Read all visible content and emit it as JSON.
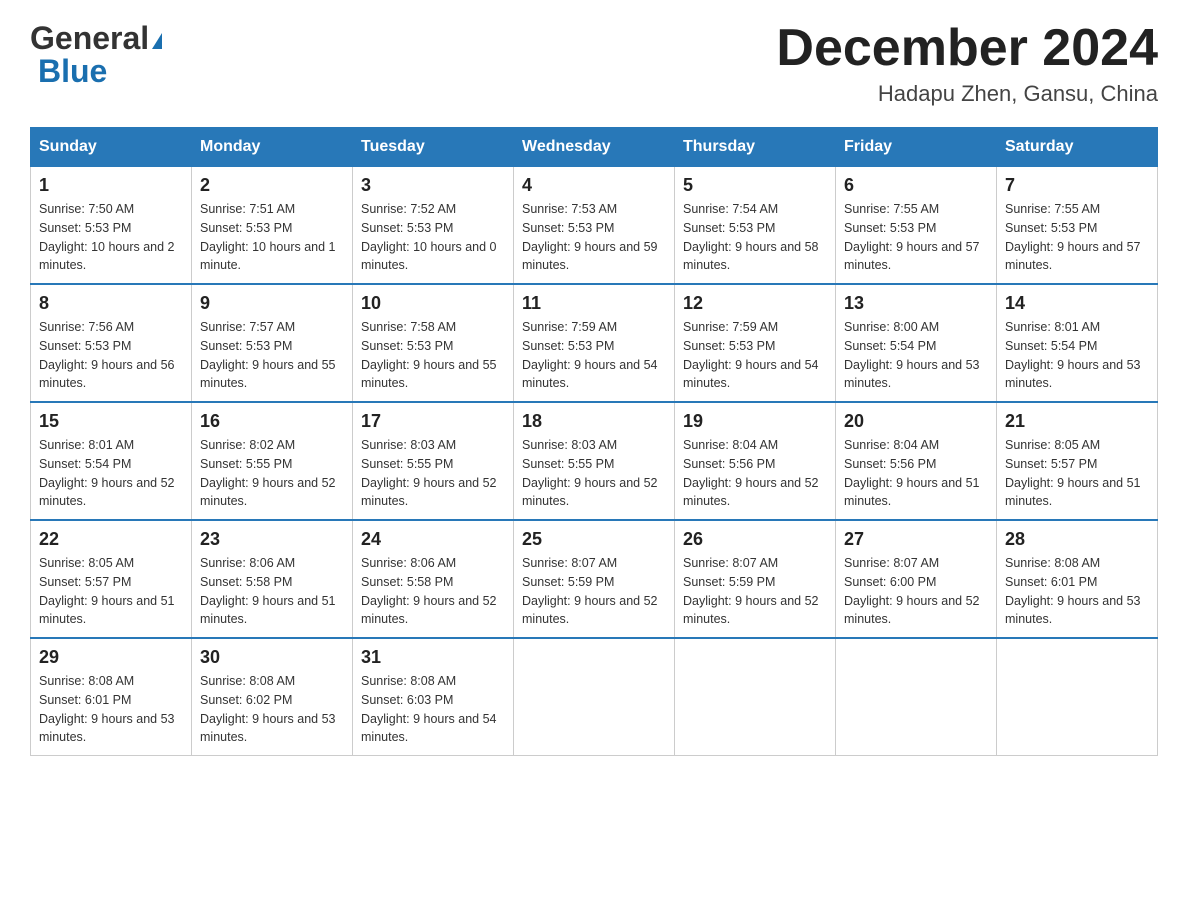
{
  "header": {
    "logo_general": "General",
    "logo_blue": "Blue",
    "title": "December 2024",
    "subtitle": "Hadapu Zhen, Gansu, China"
  },
  "days_of_week": [
    "Sunday",
    "Monday",
    "Tuesday",
    "Wednesday",
    "Thursday",
    "Friday",
    "Saturday"
  ],
  "weeks": [
    [
      {
        "day": "1",
        "sunrise": "7:50 AM",
        "sunset": "5:53 PM",
        "daylight": "10 hours and 2 minutes."
      },
      {
        "day": "2",
        "sunrise": "7:51 AM",
        "sunset": "5:53 PM",
        "daylight": "10 hours and 1 minute."
      },
      {
        "day": "3",
        "sunrise": "7:52 AM",
        "sunset": "5:53 PM",
        "daylight": "10 hours and 0 minutes."
      },
      {
        "day": "4",
        "sunrise": "7:53 AM",
        "sunset": "5:53 PM",
        "daylight": "9 hours and 59 minutes."
      },
      {
        "day": "5",
        "sunrise": "7:54 AM",
        "sunset": "5:53 PM",
        "daylight": "9 hours and 58 minutes."
      },
      {
        "day": "6",
        "sunrise": "7:55 AM",
        "sunset": "5:53 PM",
        "daylight": "9 hours and 57 minutes."
      },
      {
        "day": "7",
        "sunrise": "7:55 AM",
        "sunset": "5:53 PM",
        "daylight": "9 hours and 57 minutes."
      }
    ],
    [
      {
        "day": "8",
        "sunrise": "7:56 AM",
        "sunset": "5:53 PM",
        "daylight": "9 hours and 56 minutes."
      },
      {
        "day": "9",
        "sunrise": "7:57 AM",
        "sunset": "5:53 PM",
        "daylight": "9 hours and 55 minutes."
      },
      {
        "day": "10",
        "sunrise": "7:58 AM",
        "sunset": "5:53 PM",
        "daylight": "9 hours and 55 minutes."
      },
      {
        "day": "11",
        "sunrise": "7:59 AM",
        "sunset": "5:53 PM",
        "daylight": "9 hours and 54 minutes."
      },
      {
        "day": "12",
        "sunrise": "7:59 AM",
        "sunset": "5:53 PM",
        "daylight": "9 hours and 54 minutes."
      },
      {
        "day": "13",
        "sunrise": "8:00 AM",
        "sunset": "5:54 PM",
        "daylight": "9 hours and 53 minutes."
      },
      {
        "day": "14",
        "sunrise": "8:01 AM",
        "sunset": "5:54 PM",
        "daylight": "9 hours and 53 minutes."
      }
    ],
    [
      {
        "day": "15",
        "sunrise": "8:01 AM",
        "sunset": "5:54 PM",
        "daylight": "9 hours and 52 minutes."
      },
      {
        "day": "16",
        "sunrise": "8:02 AM",
        "sunset": "5:55 PM",
        "daylight": "9 hours and 52 minutes."
      },
      {
        "day": "17",
        "sunrise": "8:03 AM",
        "sunset": "5:55 PM",
        "daylight": "9 hours and 52 minutes."
      },
      {
        "day": "18",
        "sunrise": "8:03 AM",
        "sunset": "5:55 PM",
        "daylight": "9 hours and 52 minutes."
      },
      {
        "day": "19",
        "sunrise": "8:04 AM",
        "sunset": "5:56 PM",
        "daylight": "9 hours and 52 minutes."
      },
      {
        "day": "20",
        "sunrise": "8:04 AM",
        "sunset": "5:56 PM",
        "daylight": "9 hours and 51 minutes."
      },
      {
        "day": "21",
        "sunrise": "8:05 AM",
        "sunset": "5:57 PM",
        "daylight": "9 hours and 51 minutes."
      }
    ],
    [
      {
        "day": "22",
        "sunrise": "8:05 AM",
        "sunset": "5:57 PM",
        "daylight": "9 hours and 51 minutes."
      },
      {
        "day": "23",
        "sunrise": "8:06 AM",
        "sunset": "5:58 PM",
        "daylight": "9 hours and 51 minutes."
      },
      {
        "day": "24",
        "sunrise": "8:06 AM",
        "sunset": "5:58 PM",
        "daylight": "9 hours and 52 minutes."
      },
      {
        "day": "25",
        "sunrise": "8:07 AM",
        "sunset": "5:59 PM",
        "daylight": "9 hours and 52 minutes."
      },
      {
        "day": "26",
        "sunrise": "8:07 AM",
        "sunset": "5:59 PM",
        "daylight": "9 hours and 52 minutes."
      },
      {
        "day": "27",
        "sunrise": "8:07 AM",
        "sunset": "6:00 PM",
        "daylight": "9 hours and 52 minutes."
      },
      {
        "day": "28",
        "sunrise": "8:08 AM",
        "sunset": "6:01 PM",
        "daylight": "9 hours and 53 minutes."
      }
    ],
    [
      {
        "day": "29",
        "sunrise": "8:08 AM",
        "sunset": "6:01 PM",
        "daylight": "9 hours and 53 minutes."
      },
      {
        "day": "30",
        "sunrise": "8:08 AM",
        "sunset": "6:02 PM",
        "daylight": "9 hours and 53 minutes."
      },
      {
        "day": "31",
        "sunrise": "8:08 AM",
        "sunset": "6:03 PM",
        "daylight": "9 hours and 54 minutes."
      },
      null,
      null,
      null,
      null
    ]
  ]
}
